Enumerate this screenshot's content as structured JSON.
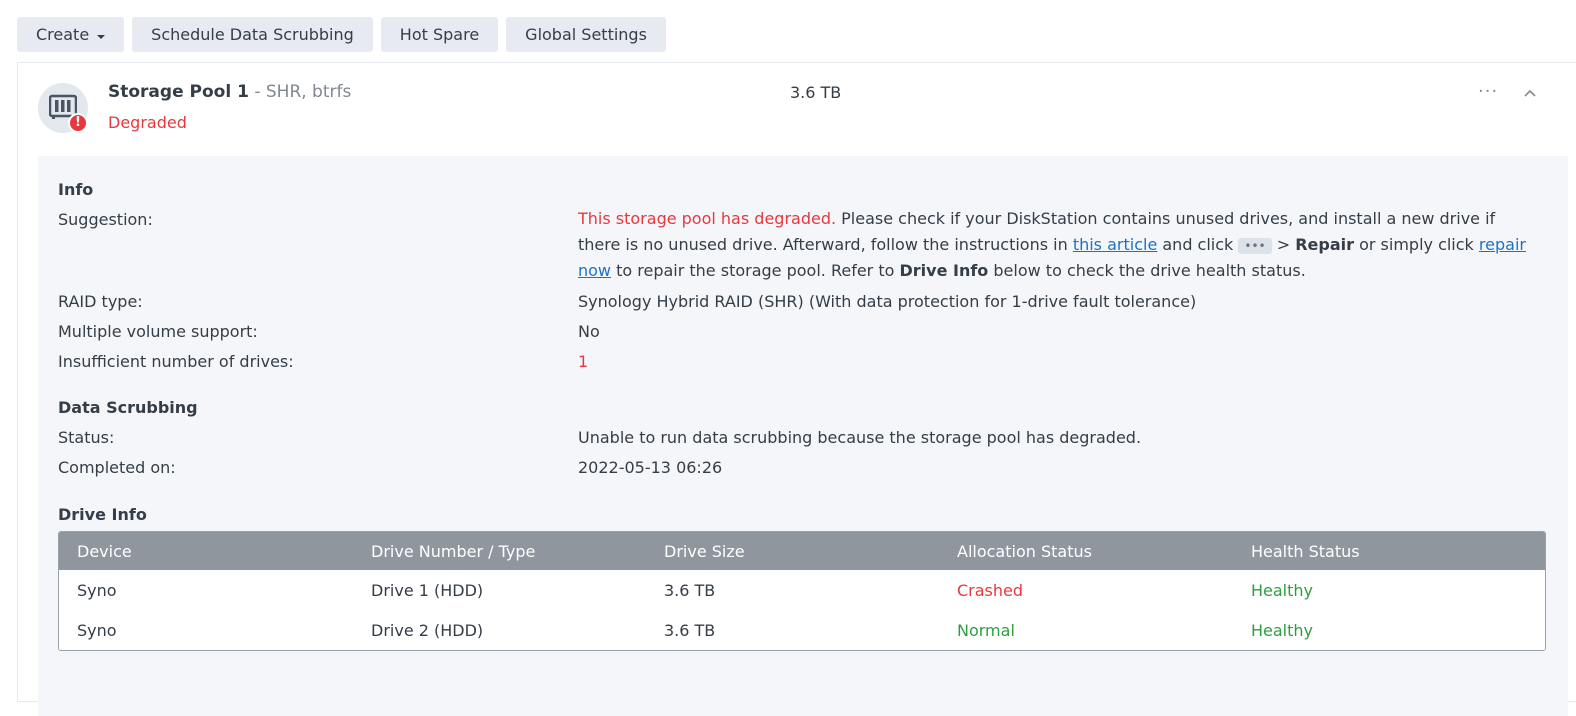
{
  "toolbar": {
    "create_label": "Create",
    "scrub_label": "Schedule Data Scrubbing",
    "hot_spare_label": "Hot Spare",
    "global_label": "Global Settings"
  },
  "pool": {
    "name": "Storage Pool 1",
    "sub": " - SHR, btrfs",
    "status": "Degraded",
    "size": "3.6 TB",
    "more": "···"
  },
  "info": {
    "title": "Info",
    "suggestion_label": "Suggestion:",
    "suggestion": {
      "warning": "This storage pool has degraded.",
      "text1": " Please check if your DiskStation contains unused drives, and install a new drive if there is no unused drive. Afterward, follow the instructions in ",
      "link1": "this article",
      "text2": " and click ",
      "chip": "•••",
      "text3": " > ",
      "repair": "Repair",
      "text4": " or simply click ",
      "link2": "repair now",
      "text5": " to repair the storage pool. Refer to ",
      "drive_info": "Drive Info",
      "text6": " below to check the drive health status."
    },
    "raid_label": "RAID type:",
    "raid_value": "Synology Hybrid RAID (SHR) (With data protection for 1-drive fault tolerance)",
    "multi_label": "Multiple volume support:",
    "multi_value": "No",
    "insuff_label": "Insufficient number of drives:",
    "insuff_value": "1"
  },
  "scrubbing": {
    "title": "Data Scrubbing",
    "status_label": "Status:",
    "status_value": "Unable to run data scrubbing because the storage pool has degraded.",
    "completed_label": "Completed on:",
    "completed_value": "2022-05-13 06:26"
  },
  "drive_info": {
    "title": "Drive Info",
    "headers": [
      "Device",
      "Drive Number / Type",
      "Drive Size",
      "Allocation Status",
      "Health Status"
    ],
    "rows": [
      [
        "Syno",
        "Drive 1 (HDD)",
        "3.6 TB",
        "Crashed",
        "Healthy"
      ],
      [
        "Syno",
        "Drive 2 (HDD)",
        "3.6 TB",
        "Normal",
        "Healthy"
      ]
    ]
  },
  "colors": {
    "error": "#e5393f",
    "ok": "#2e9e3e",
    "link": "#1a73c9",
    "header_bg": "#8f969e"
  }
}
